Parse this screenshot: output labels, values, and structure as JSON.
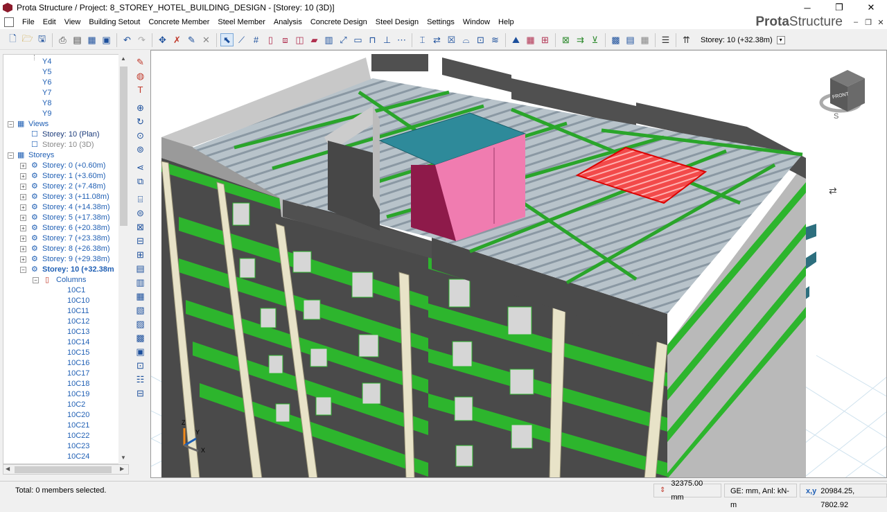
{
  "window": {
    "title": "Prota Structure / Project: 8_STOREY_HOTEL_BUILDING_DESIGN - [Storey: 10 (3D)]",
    "minimize": "─",
    "restore": "❐",
    "close": "✕"
  },
  "menu": {
    "items": [
      "File",
      "Edit",
      "View",
      "Building Setout",
      "Concrete Member",
      "Steel Member",
      "Analysis",
      "Concrete Design",
      "Steel Design",
      "Settings",
      "Window",
      "Help"
    ],
    "brand_bold": "Prota",
    "brand_light": "Structure",
    "mdi_min": "–",
    "mdi_restore": "❐",
    "mdi_close": "✕"
  },
  "toolbar": {
    "storey_label": "Storey: 10 (+32.38m)",
    "dropdown_glyph": "▾"
  },
  "tree": {
    "axes": [
      "Y4",
      "Y5",
      "Y6",
      "Y7",
      "Y8",
      "Y9"
    ],
    "views_label": "Views",
    "views": [
      "Storey: 10 (Plan)",
      "Storey: 10 (3D)"
    ],
    "storeys_label": "Storeys",
    "storeys": [
      "Storey: 0 (+0.60m)",
      "Storey: 1 (+3.60m)",
      "Storey: 2 (+7.48m)",
      "Storey: 3 (+11.08m)",
      "Storey: 4 (+14.38m)",
      "Storey: 5 (+17.38m)",
      "Storey: 6 (+20.38m)",
      "Storey: 7 (+23.38m)",
      "Storey: 8 (+26.38m)",
      "Storey: 9 (+29.38m)",
      "Storey: 10 (+32.38m"
    ],
    "columns_label": "Columns",
    "columns": [
      "10C1",
      "10C10",
      "10C11",
      "10C12",
      "10C13",
      "10C14",
      "10C15",
      "10C16",
      "10C17",
      "10C18",
      "10C19",
      "10C2",
      "10C20",
      "10C21",
      "10C22",
      "10C23",
      "10C24"
    ]
  },
  "viewcube": {
    "face": "FRONT",
    "compass": "S"
  },
  "axis_labels": {
    "z": "Z",
    "y": "Y",
    "x": "X"
  },
  "status": {
    "selection": "Total: 0 members selected.",
    "elevation": "32375.00 mm",
    "units": "GE: mm,  Anl: kN-m",
    "coords_label": "x,y",
    "coords": "20984.25, 7802.92"
  },
  "colors": {
    "accent_blue": "#1f5fb4",
    "slab_green": "#2db52d",
    "wall_gray": "#555555"
  }
}
